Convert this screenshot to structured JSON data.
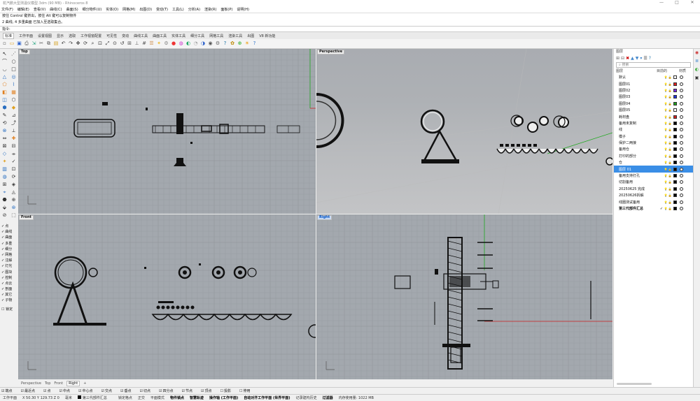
{
  "window": {
    "title": "杭汽鹏大型测温仪模型.3dm (90 MB) - Rhinoceros 8",
    "controls": [
      "—",
      "□",
      "✕"
    ]
  },
  "menu": [
    "文件(F)",
    "编辑(E)",
    "查看(V)",
    "曲线(C)",
    "曲面(S)",
    "细分物件(U)",
    "实体(O)",
    "网格(M)",
    "出图(D)",
    "变动(T)",
    "工具(L)",
    "分析(A)",
    "渲染(R)",
    "面板(P)",
    "说明(H)"
  ],
  "command_history": [
    "按住 Control 键挤出，按住 Alt 键可以复制物件",
    "2 曲线, 4 多重曲面 已加入至选取集合。"
  ],
  "command_prompt": "指令:",
  "toolbar_tabs": [
    "标准",
    "工作平面",
    "设置视图",
    "显示",
    "选取",
    "工作视窗配置",
    "可见性",
    "变动",
    "曲线工具",
    "曲面工具",
    "实体工具",
    "细分工具",
    "网格工具",
    "渲染工具",
    "出图",
    "V8 新功能"
  ],
  "active_toolbar_tab": "标准",
  "toolbar_icons": [
    "new-icon",
    "open-icon",
    "save-icon",
    "print-icon",
    "import-icon",
    "cut-icon",
    "copy-icon",
    "paste-icon",
    "undo-icon",
    "redo-icon",
    "pan-icon",
    "rotate-view-icon",
    "zoom-icon",
    "zoom-window-icon",
    "zoom-extents-icon",
    "zoom-selected-icon",
    "undo-view-icon",
    "four-views-icon",
    "cplane-icon",
    "grid-icon",
    "layer-icon",
    "light-icon",
    "properties-icon",
    "render-icon",
    "material-icon",
    "display-mode-icon",
    "ghosted-icon",
    "xray-icon",
    "rendered-icon",
    "options-icon",
    "help-icon",
    "gear-icon",
    "object-snap-icon",
    "sun-icon",
    "help-bubble-icon"
  ],
  "viewports": {
    "top": "Top",
    "perspective": "Perspective",
    "front": "Front",
    "right": "Right"
  },
  "viewport_tabs": [
    "Perspective",
    "Top",
    "Front",
    "Right"
  ],
  "active_viewport_tab": "Right",
  "left_snaps": [
    "点",
    "曲线",
    "曲面",
    "多重",
    "细分",
    "网格",
    "注解",
    "灯光",
    "图块",
    "控制",
    "点云",
    "剖面",
    "其它",
    "子物"
  ],
  "left_snaps_extra": "锁定",
  "osnap_bar": [
    "端点",
    "最近点",
    "点",
    "中点",
    "中心点",
    "交点",
    "垂点",
    "切点",
    "四分点",
    "节点",
    "顶点",
    "投影",
    "停用"
  ],
  "status": {
    "cplane": "工作平面",
    "coords": "X 50.30 Y 129.73 Z 0",
    "units": "毫米",
    "layer": "第三代部件汇总",
    "items": [
      "锁定格点",
      "正交",
      "平面模式",
      "物件锁点",
      "智慧轨迹",
      "操作轴 (工作平面)",
      "自动对齐工作平面 (世界平面)",
      "记录建构历史",
      "过滤器"
    ],
    "bold_items": [
      "物件锁点",
      "智慧轨迹",
      "操作轴 (工作平面)",
      "自动对齐工作平面 (世界平面)",
      "过滤器"
    ],
    "memory": "内存使用量: 1022 MB"
  },
  "layers_panel": {
    "title": "图层",
    "search_placeholder": "搜索",
    "columns": [
      "图层",
      "目前的",
      "材质"
    ],
    "rows": [
      {
        "name": "默认",
        "color": "#ffffff",
        "current": false
      },
      {
        "name": "图层01",
        "color": "#e02020",
        "current": false
      },
      {
        "name": "图层02",
        "color": "#7a2ae0",
        "current": false
      },
      {
        "name": "图层03",
        "color": "#2030e0",
        "current": false
      },
      {
        "name": "图层04",
        "color": "#20a020",
        "current": false
      },
      {
        "name": "图层05",
        "color": "#ffffff",
        "current": false
      },
      {
        "name": "耗材盘",
        "color": "#d02020",
        "current": false
      },
      {
        "name": "备用未复制",
        "color": "#000000",
        "current": false
      },
      {
        "name": "线",
        "color": "#000000",
        "current": false
      },
      {
        "name": "模子",
        "color": "#000000",
        "current": false
      },
      {
        "name": "保护二两接",
        "color": "#000000",
        "current": false
      },
      {
        "name": "备用仓",
        "color": "#000000",
        "current": false
      },
      {
        "name": "打印的部分",
        "color": "#000000",
        "current": false
      },
      {
        "name": "仓",
        "color": "#000000",
        "current": false
      },
      {
        "name": "图层 01",
        "color": "#000000",
        "current": false,
        "selected": true
      },
      {
        "name": "备用支持打孔",
        "color": "#000000",
        "current": false
      },
      {
        "name": "切割备用",
        "color": "#000000",
        "current": false
      },
      {
        "name": "20250625 完成",
        "color": "#000000",
        "current": false
      },
      {
        "name": "20250626拆解",
        "color": "#000000",
        "current": false
      },
      {
        "name": "线圈测试备用",
        "color": "#000000",
        "current": false
      },
      {
        "name": "第三代部件汇总",
        "color": "#000000",
        "current": true
      }
    ]
  }
}
